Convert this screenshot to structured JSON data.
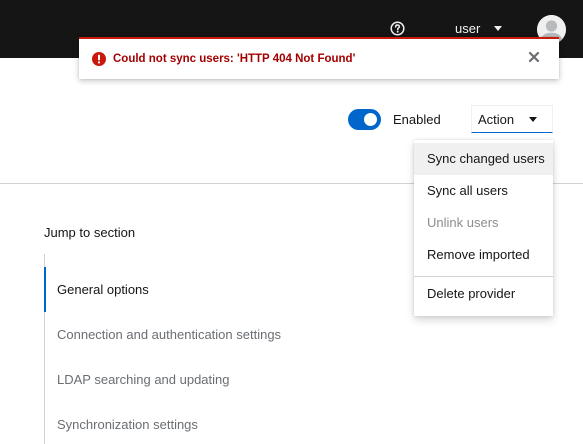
{
  "header": {
    "help_icon": "question-circle-icon",
    "user_menu_label": "user",
    "avatar_icon": "user-avatar-icon"
  },
  "alert": {
    "variant": "danger",
    "icon": "exclamation-circle-icon",
    "title": "Could not sync users: 'HTTP 404 Not Found'",
    "close_icon": "close-icon",
    "color": "#c9190b"
  },
  "toolbar": {
    "toggle_state": "on",
    "toggle_label": "Enabled",
    "action_label": "Action",
    "accent_color": "#0066cc"
  },
  "action_menu": {
    "items": [
      {
        "label": "Sync changed users",
        "state": "hovered"
      },
      {
        "label": "Sync all users",
        "state": "enabled"
      },
      {
        "label": "Unlink users",
        "state": "disabled"
      },
      {
        "label": "Remove imported",
        "state": "enabled"
      }
    ],
    "danger_items": [
      {
        "label": "Delete provider",
        "state": "enabled"
      }
    ]
  },
  "jump_to_section": {
    "title": "Jump to section",
    "links": [
      {
        "label": "General options",
        "active": true
      },
      {
        "label": "Connection and authentication settings",
        "active": false
      },
      {
        "label": "LDAP searching and updating",
        "active": false
      },
      {
        "label": "Synchronization settings",
        "active": false
      }
    ]
  }
}
